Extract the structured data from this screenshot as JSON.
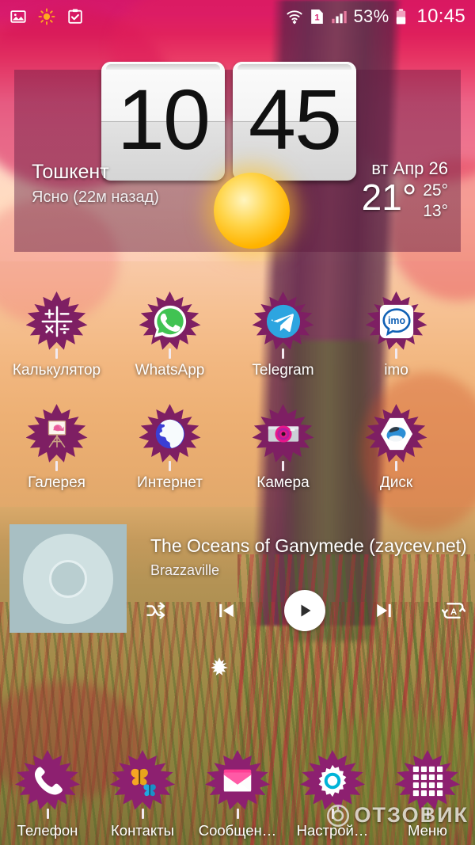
{
  "statusbar": {
    "left_icons": [
      {
        "name": "screenshot-icon",
        "label": "screenshot"
      },
      {
        "name": "brightness-icon",
        "label": "brightness"
      },
      {
        "name": "clipboard-check-icon",
        "label": "clipboard"
      }
    ],
    "wifi_icon": "wifi-icon",
    "sim_label": "1",
    "signal_icon": "signal-bars-icon",
    "battery_percent": "53%",
    "battery_icon": "battery-icon",
    "clock": "10:45"
  },
  "clock_widget": {
    "hours": "10",
    "minutes": "45",
    "weather_icon": "sun-icon",
    "city": "Тошкент",
    "condition": "Ясно (22м назад)",
    "date": "вт Апр 26",
    "temp_now": "21°",
    "temp_high": "25°",
    "temp_low": "13°"
  },
  "apps": [
    [
      {
        "label": "Калькулятор",
        "icon": "calculator-icon"
      },
      {
        "label": "WhatsApp",
        "icon": "whatsapp-icon"
      },
      {
        "label": "Telegram",
        "icon": "telegram-icon"
      },
      {
        "label": "imo",
        "icon": "imo-icon"
      }
    ],
    [
      {
        "label": "Галерея",
        "icon": "gallery-icon"
      },
      {
        "label": "Интернет",
        "icon": "browser-globe-icon"
      },
      {
        "label": "Камера",
        "icon": "camera-icon"
      },
      {
        "label": "Диск",
        "icon": "yandex-disk-icon"
      }
    ]
  ],
  "music": {
    "title": "The Oceans of Ganymede (zaycev.net)",
    "artist": "Brazzaville",
    "album_art_icon": "cd-placeholder-icon",
    "controls": [
      {
        "name": "shuffle-button",
        "icon": "shuffle-icon"
      },
      {
        "name": "previous-button",
        "icon": "skip-previous-icon"
      },
      {
        "name": "play-button",
        "icon": "play-icon"
      },
      {
        "name": "next-button",
        "icon": "skip-next-icon"
      },
      {
        "name": "repeat-button",
        "icon": "repeat-all-icon"
      }
    ]
  },
  "page_indicator": "maple-leaf-icon",
  "dock": [
    {
      "label": "Телефон",
      "icon": "phone-icon"
    },
    {
      "label": "Контакты",
      "icon": "butterflies-icon"
    },
    {
      "label": "Сообщен…",
      "icon": "envelope-icon"
    },
    {
      "label": "Настрой…",
      "icon": "gear-icon"
    },
    {
      "label": "Меню",
      "icon": "app-grid-icon"
    }
  ],
  "watermark": {
    "text": "ОТЗОВИК",
    "icon": "otzovik-logo-icon"
  },
  "colors": {
    "leaf_purple": "#7e1f63",
    "dock_leaf_purple": "#8d2070",
    "accent_sun": "#ffb400",
    "settings_cyan": "#00b4d8"
  }
}
